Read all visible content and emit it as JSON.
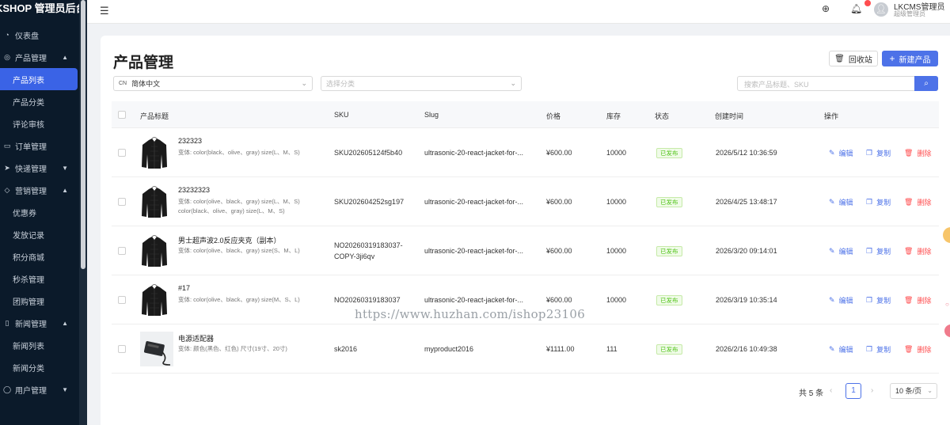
{
  "brand": "KSHOP 管理员后台",
  "sidebar": {
    "dashboard": "仪表盘",
    "product_group": "产品管理",
    "product_list": "产品列表",
    "product_category": "产品分类",
    "review": "评论审核",
    "order": "订单管理",
    "express": "快递管理",
    "marketing": "营销管理",
    "coupon": "优惠券",
    "issue_record": "发放记录",
    "points_mall": "积分商城",
    "flash_sale": "秒杀管理",
    "group_buy": "团购管理",
    "news": "新闻管理",
    "news_list": "新闻列表",
    "news_category": "新闻分类",
    "user": "用户管理"
  },
  "header": {
    "user_name": "LKCMS管理员",
    "user_role": "超级管理员"
  },
  "page": {
    "title": "产品管理",
    "recycle_label": "回收站",
    "new_label": "新建产品"
  },
  "filters": {
    "lang_code": "CN",
    "lang_value": "简体中文",
    "category_placeholder": "选择分类",
    "search_placeholder": "搜索产品标题、SKU"
  },
  "table": {
    "headers": {
      "title": "产品标题",
      "sku": "SKU",
      "slug": "Slug",
      "price": "价格",
      "stock": "库存",
      "status": "状态",
      "created": "创建时间",
      "actions": "操作"
    },
    "action_labels": {
      "edit": "编辑",
      "copy": "复制",
      "delete": "删除"
    },
    "rows": [
      {
        "title": "232323",
        "variant1": "变体: color(black、olive、gray) size(L、M、S)",
        "variant2": "",
        "sku1": "SKU202605124f5b40",
        "sku2": "",
        "slug": "ultrasonic-20-react-jacket-for-...",
        "price": "¥600.00",
        "stock": "10000",
        "status": "已发布",
        "created": "2026/5/12 10:36:59",
        "thumb": "jacket"
      },
      {
        "title": "23232323",
        "variant1": "变体: color(olive、black、gray) size(L、M、S)",
        "variant2": "color(black、olive、gray) size(L、M、S)",
        "sku1": "SKU202604252sg197",
        "sku2": "",
        "slug": "ultrasonic-20-react-jacket-for-...",
        "price": "¥600.00",
        "stock": "10000",
        "status": "已发布",
        "created": "2026/4/25 13:48:17",
        "thumb": "jacket"
      },
      {
        "title": "男士超声波2.0反应夹克（副本）",
        "variant1": "变体: color(olive、black、gray) size(S、M、L)",
        "variant2": "",
        "sku1": "NO20260319183037-",
        "sku2": "COPY-3ji6qv",
        "slug": "ultrasonic-20-react-jacket-for-...",
        "price": "¥600.00",
        "stock": "10000",
        "status": "已发布",
        "created": "2026/3/20 09:14:01",
        "thumb": "jacket"
      },
      {
        "title": "#17",
        "variant1": "变体: color(olive、black、gray) size(M、S、L)",
        "variant2": "",
        "sku1": "NO20260319183037",
        "sku2": "",
        "slug": "ultrasonic-20-react-jacket-for-...",
        "price": "¥600.00",
        "stock": "10000",
        "status": "已发布",
        "created": "2026/3/19 10:35:14",
        "thumb": "jacket"
      },
      {
        "title": "电源适配器",
        "variant1": "变体: 颜色(黑色、红色) 尺寸(19寸、20寸)",
        "variant2": "",
        "sku1": "sk2016",
        "sku2": "",
        "slug": "myproduct2016",
        "price": "¥1111.00",
        "stock": "111",
        "status": "已发布",
        "created": "2026/2/16 10:49:38",
        "thumb": "adapter"
      }
    ]
  },
  "pagination": {
    "total": "共 5 条",
    "current": "1",
    "page_size": "10 条/页"
  },
  "watermark": "https://www.huzhan.com/ishop23106",
  "colors": {
    "primary": "#4d72e8",
    "danger": "#ff4d4f",
    "success": "#52c41a",
    "sidebar_bg": "#0b1a2a"
  }
}
